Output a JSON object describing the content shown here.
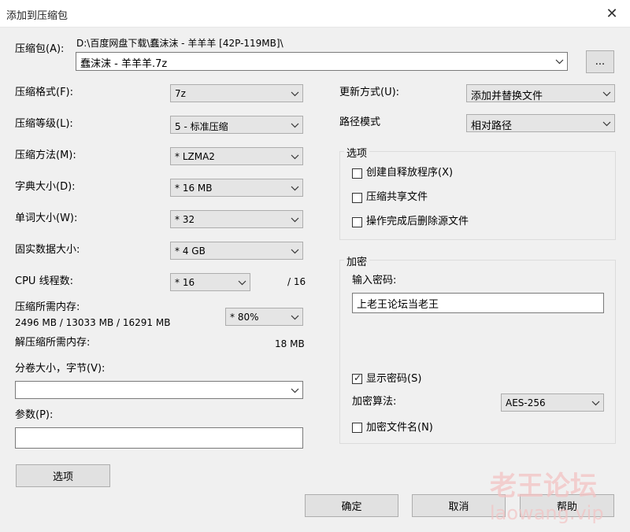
{
  "window": {
    "title": "添加到压缩包",
    "close_glyph": "✕"
  },
  "archive": {
    "label": "压缩包(A):",
    "path": "D:\\百度网盘下载\\蠢沫沫 - 羊羊羊 [42P-119MB]\\",
    "filename": "蠢沫沫 - 羊羊羊.7z",
    "browse_label": "..."
  },
  "left": {
    "format": {
      "label": "压缩格式(F):",
      "value": "7z"
    },
    "level": {
      "label": "压缩等级(L):",
      "value": "5 - 标准压缩"
    },
    "method": {
      "label": "压缩方法(M):",
      "value": "* LZMA2"
    },
    "dict": {
      "label": "字典大小(D):",
      "value": "* 16 MB"
    },
    "word": {
      "label": "单词大小(W):",
      "value": "* 32"
    },
    "solid": {
      "label": "固实数据大小:",
      "value": "* 4 GB"
    },
    "threads": {
      "label": "CPU 线程数:",
      "value": "* 16",
      "max": "/ 16"
    },
    "memory": {
      "label": "压缩所需内存:",
      "detail": "2496 MB / 13033 MB / 16291 MB",
      "value": "* 80%"
    },
    "decomp": {
      "label": "解压缩所需内存:",
      "value": "18 MB"
    },
    "volume": {
      "label": "分卷大小，字节(V):",
      "value": ""
    },
    "params": {
      "label": "参数(P):",
      "value": ""
    },
    "options_button": "选项"
  },
  "right": {
    "update": {
      "label": "更新方式(U):",
      "value": "添加并替换文件"
    },
    "pathmode": {
      "label": "路径模式",
      "value": "相对路径"
    },
    "options": {
      "title": "选项",
      "items": [
        {
          "label": "创建自释放程序(X)",
          "checked": false
        },
        {
          "label": "压缩共享文件",
          "checked": false
        },
        {
          "label": "操作完成后删除源文件",
          "checked": false
        }
      ]
    },
    "encryption": {
      "title": "加密",
      "password_label": "输入密码:",
      "password_value": "上老王论坛当老王",
      "show_password": {
        "label": "显示密码(S)",
        "checked": true
      },
      "algo_label": "加密算法:",
      "algo_value": "AES-256",
      "encrypt_names": {
        "label": "加密文件名(N)",
        "checked": false
      }
    }
  },
  "buttons": {
    "ok": "确定",
    "cancel": "取消",
    "help": "帮助"
  },
  "watermark": {
    "line1": "老王论坛",
    "line2": "laowang.vip"
  }
}
